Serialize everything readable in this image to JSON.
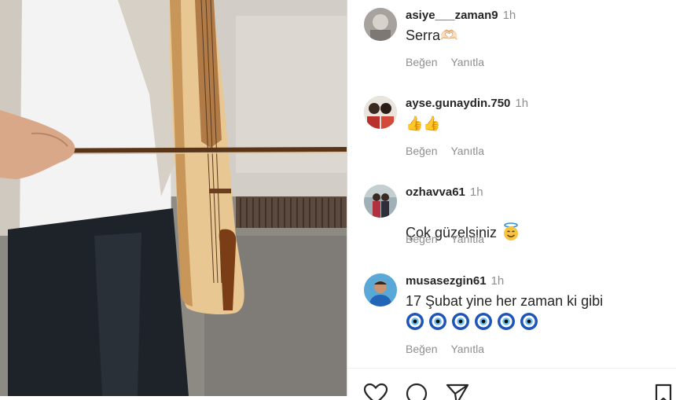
{
  "comments": [
    {
      "username": "asiye___zaman9",
      "time": "1h",
      "text": "Serra🫶🏻",
      "like_label": "Beğen",
      "reply_label": "Yanıtla",
      "avatar": "avatar-photo"
    },
    {
      "username": "ayse.gunaydin.750",
      "time": "1h",
      "text": "👍👍",
      "like_label": "Beğen",
      "reply_label": "Yanıtla",
      "avatar": "avatar-photo"
    },
    {
      "username": "ozhavva61",
      "time": "1h",
      "text": "Çok güzelsiniz",
      "emoji": "smiling-face-with-halo",
      "like_label": "Beğen",
      "reply_label": "Yanıtla",
      "avatar": "avatar-photo"
    },
    {
      "username": "musasezgin61",
      "time": "1h",
      "text": "17 Şubat yine her zaman ki gibi",
      "emoji_row": [
        "nazar-amulet",
        "nazar-amulet",
        "nazar-amulet",
        "nazar-amulet",
        "nazar-amulet",
        "nazar-amulet"
      ],
      "like_label": "Beğen",
      "reply_label": "Yanıtla",
      "avatar": "avatar-photo"
    }
  ],
  "action_bar": {
    "icons": [
      "heart-icon",
      "comment-icon",
      "share-icon",
      "save-icon"
    ]
  },
  "media": {
    "description_icon": "kemence-player-video"
  }
}
